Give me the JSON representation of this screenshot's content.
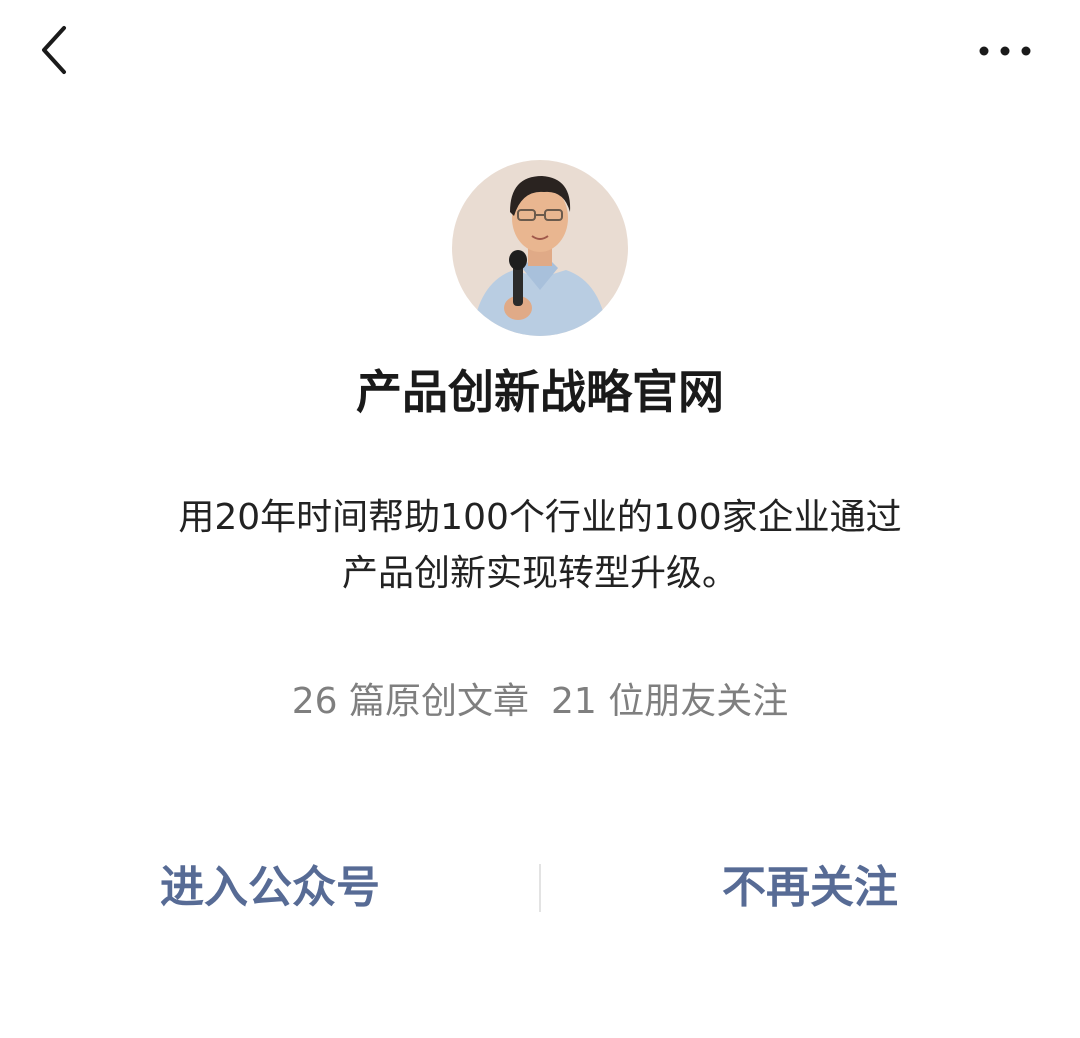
{
  "nav": {
    "back_icon": "chevron-left-icon",
    "more_icon": "more-dots-icon"
  },
  "profile": {
    "avatar": "avatar-photo",
    "name": "产品创新战略官网",
    "description_lines": [
      "用20年时间帮助100个行业的100家企业通过",
      "产品创新实现转型升级。"
    ],
    "articles_stat": "26 篇原创文章",
    "followers_stat": "21 位朋友关注"
  },
  "actions": {
    "enter_label": "进入公众号",
    "unfollow_label": "不再关注"
  },
  "colors": {
    "link": "#576b95",
    "muted": "#7f7f7f",
    "text": "#1a1a1a"
  }
}
